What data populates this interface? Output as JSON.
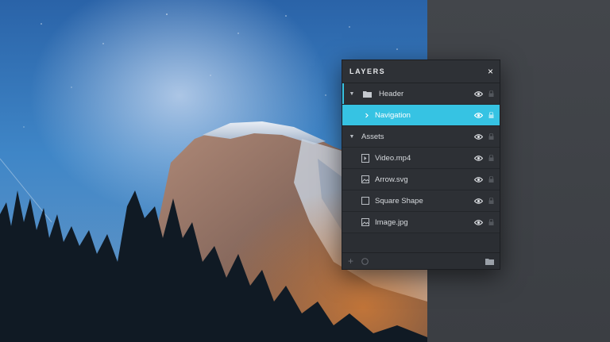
{
  "panel": {
    "title": "LAYERS",
    "close_symbol": "×"
  },
  "layers": [
    {
      "label": "Header",
      "icon": "folder-icon"
    },
    {
      "label": "Navigation",
      "icon": "chevron-right-icon",
      "selected": true
    },
    {
      "label": "Assets",
      "icon": "none"
    },
    {
      "label": "Video.mp4",
      "icon": "video-file-icon"
    },
    {
      "label": "Arrow.svg",
      "icon": "image-file-icon"
    },
    {
      "label": "Square Shape",
      "icon": "square-shape-icon"
    },
    {
      "label": "Image.jpg",
      "icon": "image-file-icon"
    }
  ],
  "footer": {
    "add_symbol": "+",
    "add_icon": "plus-icon",
    "circle_icon": "circle-icon",
    "folder_icon": "folder-icon"
  },
  "colors": {
    "accent": "#36c3e3",
    "panel_bg": "#2d3035",
    "canvas_bg": "#3a3d42"
  }
}
